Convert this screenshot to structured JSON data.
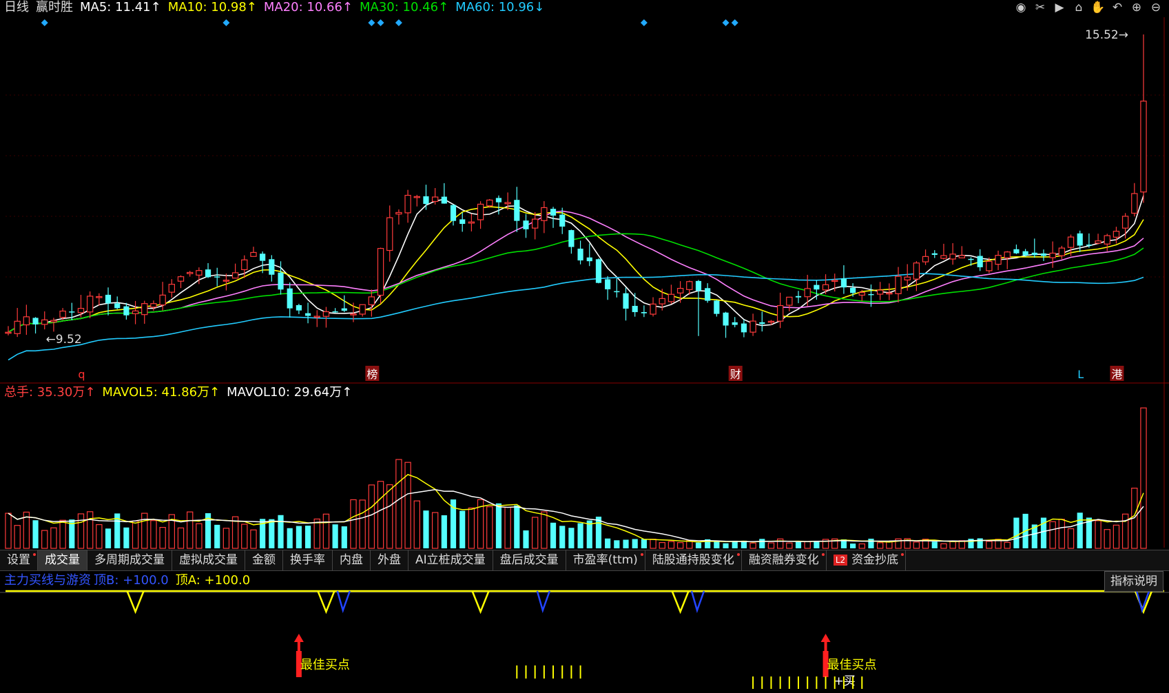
{
  "window": {
    "period_label": "日线",
    "stock_name": "赢时胜",
    "ma_legend": [
      {
        "label": "MA5: 11.41↑",
        "color": "#ffffff"
      },
      {
        "label": "MA10: 10.98↑",
        "color": "#ffff00"
      },
      {
        "label": "MA20: 10.66↑",
        "color": "#ff80ff"
      },
      {
        "label": "MA30: 10.46↑",
        "color": "#00e000"
      },
      {
        "label": "MA60: 10.96↓",
        "color": "#22ccff"
      }
    ],
    "toolbar_icons": [
      "eye-icon",
      "scissors-icon",
      "play-icon",
      "lock-icon",
      "hand-icon",
      "undo-icon",
      "zoom-in-icon",
      "zoom-out-icon"
    ]
  },
  "volume_legend": [
    {
      "label": "总手: 35.30万↑",
      "color": "#ff4040"
    },
    {
      "label": "MAVOL5: 41.86万↑",
      "color": "#ffff00"
    },
    {
      "label": "MAVOL10: 29.64万↑",
      "color": "#ffffff"
    }
  ],
  "tabs": [
    {
      "label": "设置",
      "dot": true
    },
    {
      "label": "成交量",
      "active": true
    },
    {
      "label": "多周期成交量"
    },
    {
      "label": "虚拟成交量"
    },
    {
      "label": "金额"
    },
    {
      "label": "换手率"
    },
    {
      "label": "内盘"
    },
    {
      "label": "外盘"
    },
    {
      "label": "AI立桩成交量"
    },
    {
      "label": "盘后成交量"
    },
    {
      "label": "市盈率(ttm)",
      "dot": true
    },
    {
      "label": "陆股通持股变化",
      "dot": true
    },
    {
      "label": "融资融券变化",
      "dot": true
    },
    {
      "label": "资金抄底",
      "dot": true,
      "badge": "L2"
    }
  ],
  "indicator": {
    "name": "主力买线与游资",
    "items": [
      {
        "label": "顶B: +100.0",
        "color": "#3355ff"
      },
      {
        "label": "顶A: +100.0",
        "color": "#ffff00"
      }
    ],
    "help_button": "指标说明",
    "buy_signal_label": "最佳买点",
    "buy_label": "+买",
    "buy_signals": [
      {
        "index": 32
      },
      {
        "index": 90
      }
    ]
  },
  "chart_data": {
    "type": "candlestick",
    "price_range": [
      9.52,
      15.52
    ],
    "annotations": {
      "high_label": "15.52",
      "low_label": "9.52"
    },
    "event_markers": [
      {
        "index": 8,
        "label": "q",
        "color": "#ff3030",
        "boxed": false
      },
      {
        "index": 40,
        "label": "榜",
        "color": "#ffffff",
        "boxed": true
      },
      {
        "index": 80,
        "label": "财",
        "color": "#ffffff",
        "boxed": true
      },
      {
        "index": 118,
        "label": "L",
        "color": "#22ccff",
        "boxed": false
      },
      {
        "index": 122,
        "label": "港",
        "color": "#ffffff",
        "boxed": true
      }
    ],
    "diamond_markers": [
      4,
      24,
      40,
      41,
      43,
      70,
      79,
      80
    ]
  }
}
